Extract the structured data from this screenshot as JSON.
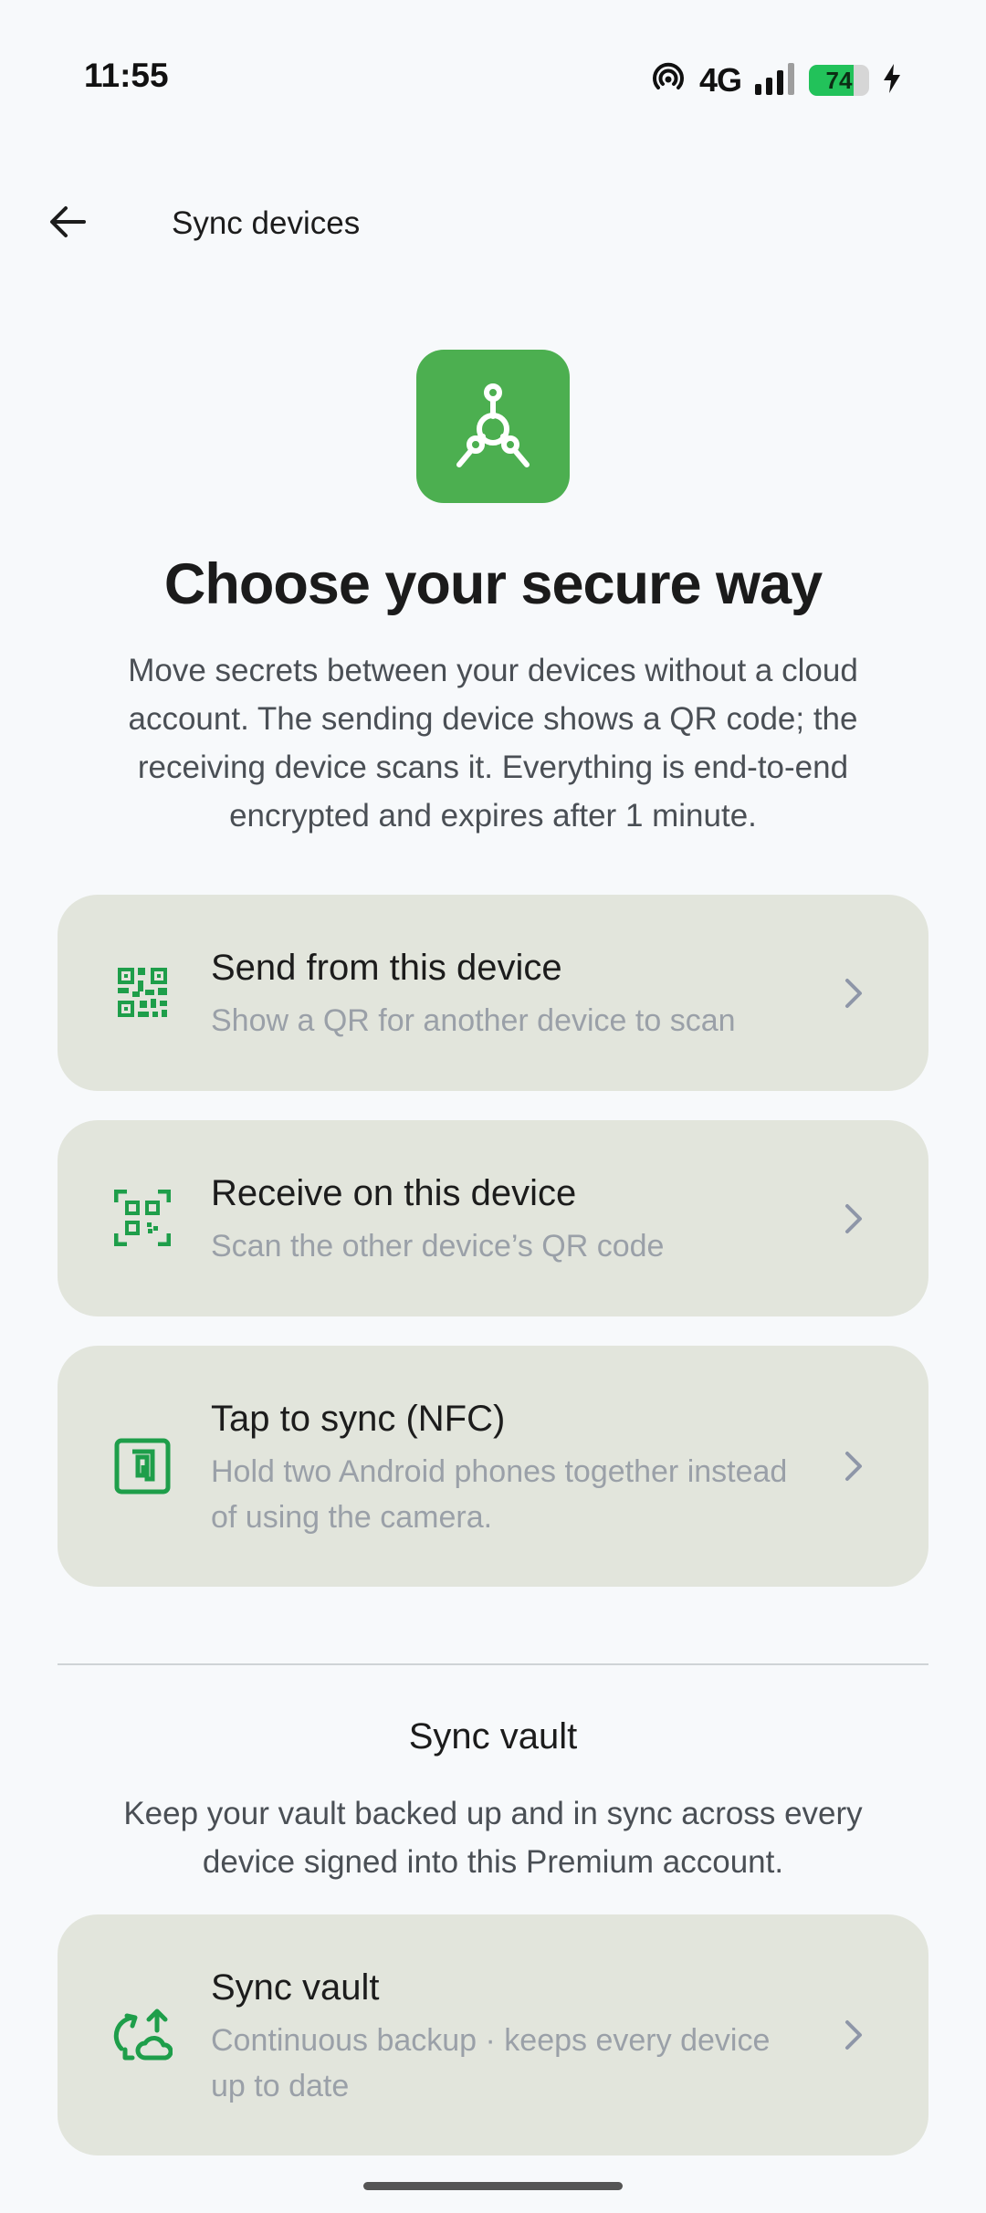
{
  "status_bar": {
    "time": "11:55",
    "network": "4G",
    "battery_level": 74,
    "battery_text": "74",
    "battery_charging": true,
    "icons": [
      "hotspot-icon",
      "signal-icon",
      "battery-icon",
      "charging-bolt-icon"
    ]
  },
  "app_bar": {
    "back_icon": "arrow-left-icon",
    "title": "Sync devices"
  },
  "hero": {
    "icon": "sync-network-icon",
    "icon_color": "#4caf50",
    "title": "Choose your secure way",
    "description": "Move secrets between your devices without a cloud account. The sending device shows a QR code; the receiving device scans it. Everything is end-to-end encrypted and expires after 1 minute."
  },
  "options": [
    {
      "icon": "qr-code-icon",
      "title": "Send from this device",
      "subtitle": "Show a QR for another device to scan"
    },
    {
      "icon": "qr-scan-icon",
      "title": "Receive on this device",
      "subtitle": "Scan the other device’s QR code"
    },
    {
      "icon": "nfc-icon",
      "title": "Tap to sync (NFC)",
      "subtitle": "Hold two Android phones together instead of using the camera."
    }
  ],
  "sync_section": {
    "title": "Sync vault",
    "description": "Keep your vault backed up and in sync across every device signed into this Premium account.",
    "card": {
      "icon": "cloud-sync-icon",
      "title": "Sync vault",
      "subtitle": "Continuous backup · keeps every device up to date"
    }
  },
  "colors": {
    "accent_green": "#1e9e4a",
    "card_background": "#e2e5dc",
    "page_background": "#f7f9fb"
  }
}
